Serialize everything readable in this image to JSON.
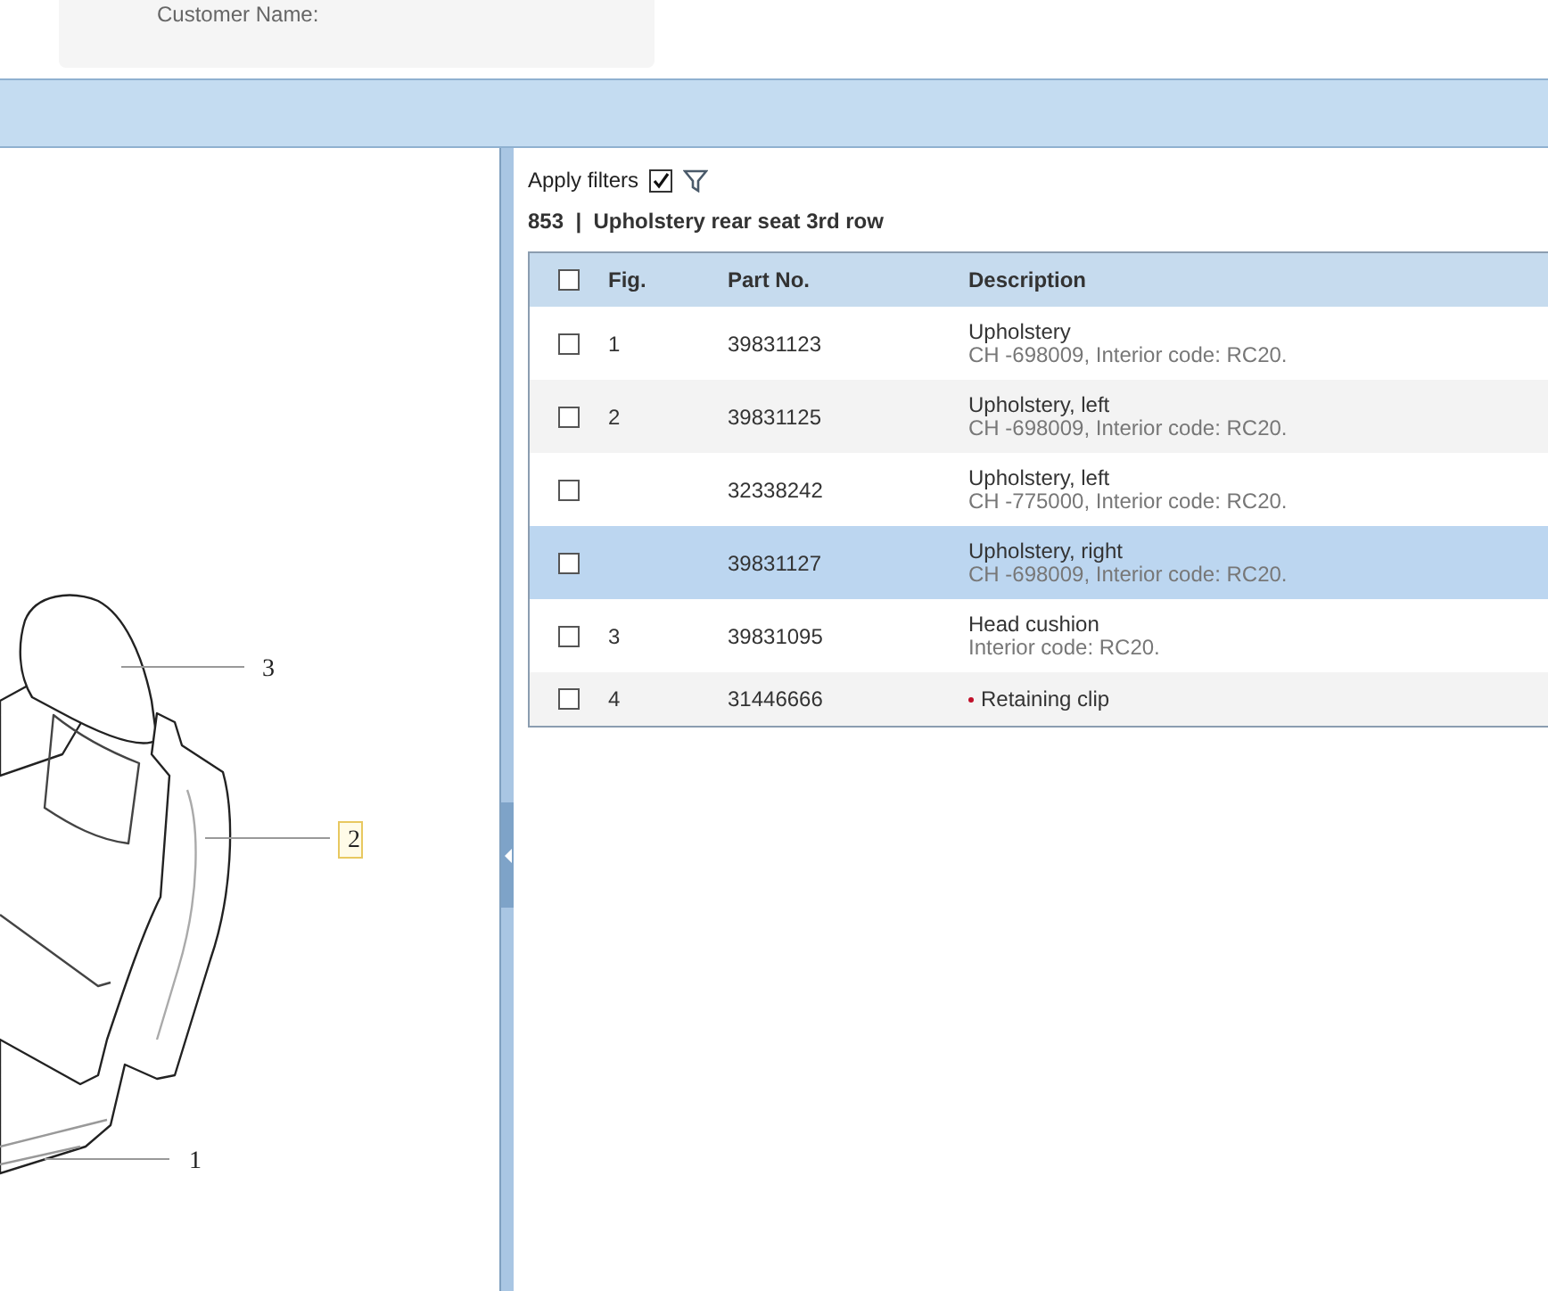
{
  "customer_card": {
    "label": "Customer Name:"
  },
  "diagram": {
    "callouts": [
      {
        "label": "3",
        "highlighted": false
      },
      {
        "label": "2",
        "highlighted": true
      },
      {
        "label": "1",
        "highlighted": false
      }
    ]
  },
  "filters": {
    "label": "Apply filters",
    "checked": true
  },
  "group_title": {
    "code": "853",
    "separator": "|",
    "name": "Upholstery rear seat 3rd row"
  },
  "table": {
    "select_all_checked": false,
    "columns": [
      "Fig.",
      "Part No.",
      "Description"
    ],
    "rows": [
      {
        "fig": "1",
        "part_no": "39831123",
        "description": "Upholstery",
        "detail": "CH -698009, Interior code: RC20.",
        "checked": false,
        "selected": false,
        "bullet": false
      },
      {
        "fig": "2",
        "part_no": "39831125",
        "description": "Upholstery, left",
        "detail": "CH -698009, Interior code: RC20.",
        "checked": false,
        "selected": false,
        "bullet": false
      },
      {
        "fig": "",
        "part_no": "32338242",
        "description": "Upholstery, left",
        "detail": "CH -775000, Interior code: RC20.",
        "checked": false,
        "selected": false,
        "bullet": false
      },
      {
        "fig": "",
        "part_no": "39831127",
        "description": "Upholstery, right",
        "detail": "CH -698009, Interior code: RC20.",
        "checked": false,
        "selected": true,
        "bullet": false
      },
      {
        "fig": "3",
        "part_no": "39831095",
        "description": "Head cushion",
        "detail": "Interior code: RC20.",
        "checked": false,
        "selected": false,
        "bullet": false
      },
      {
        "fig": "4",
        "part_no": "31446666",
        "description": "Retaining clip",
        "detail": "",
        "checked": false,
        "selected": false,
        "bullet": true
      }
    ]
  }
}
